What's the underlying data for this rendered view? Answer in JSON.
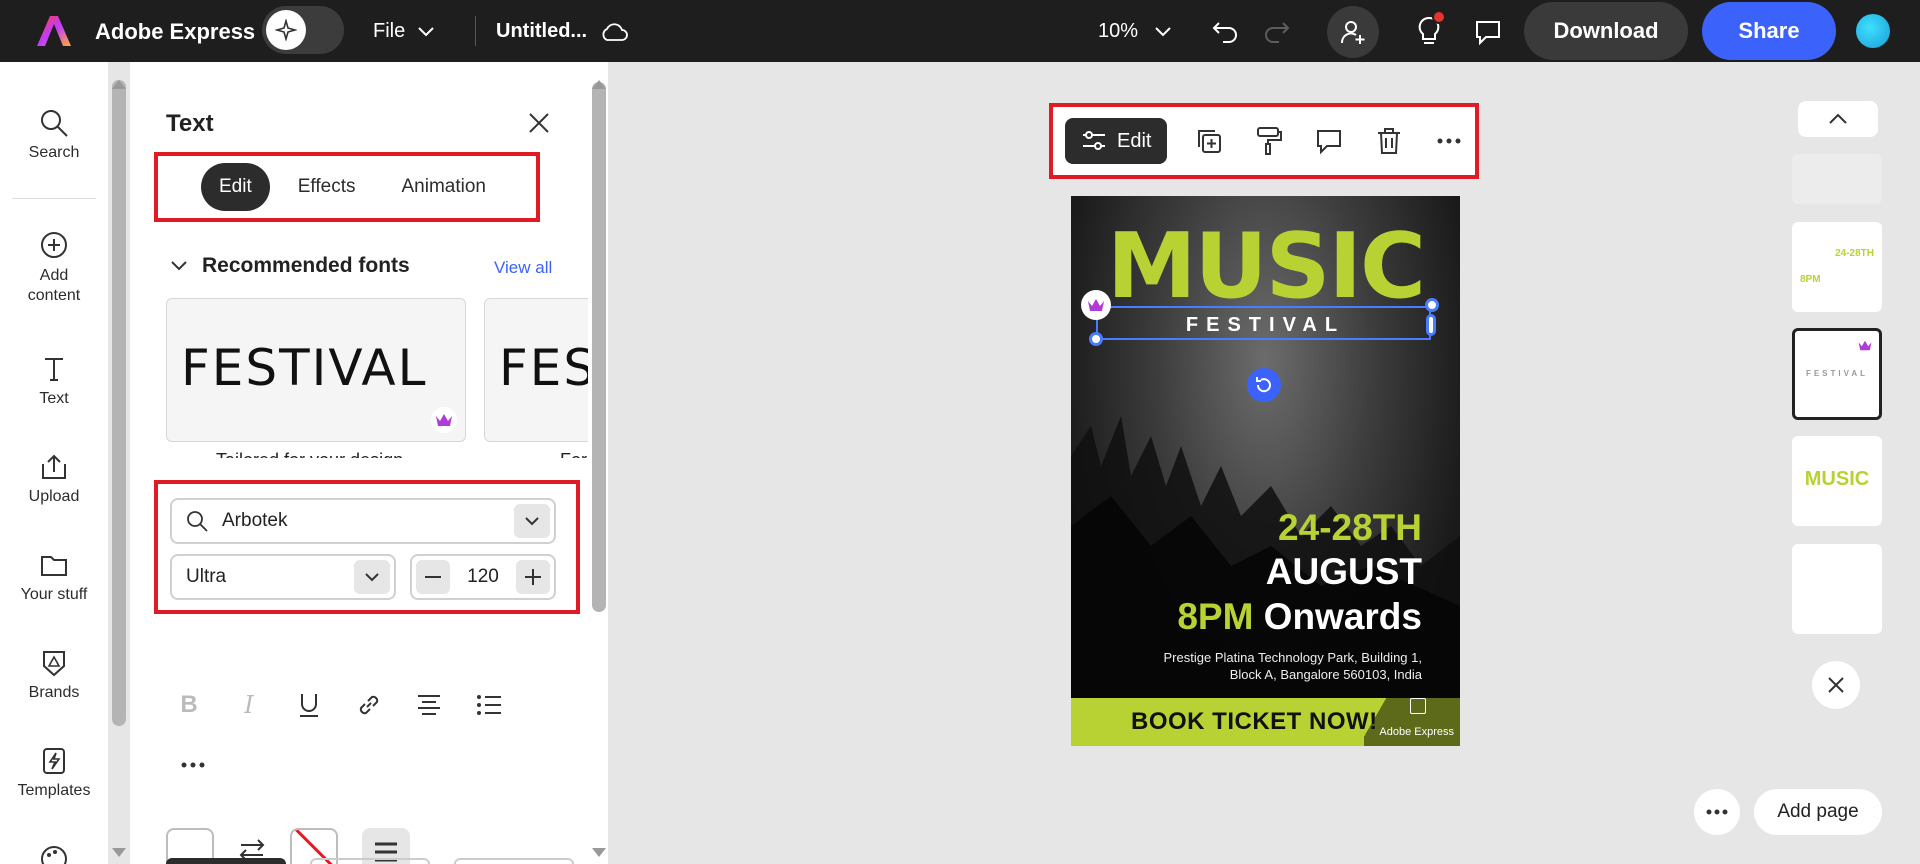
{
  "topbar": {
    "app_title": "Adobe Express",
    "file_label": "File",
    "doc_title": "Untitled...",
    "zoom": "10%",
    "download_label": "Download",
    "share_label": "Share"
  },
  "rail": {
    "items": [
      {
        "label": "Search",
        "icon": "search-icon"
      },
      {
        "label": "Add content",
        "icon": "plus-circle-icon"
      },
      {
        "label": "Text",
        "icon": "text-icon"
      },
      {
        "label": "Upload",
        "icon": "upload-icon"
      },
      {
        "label": "Your stuff",
        "icon": "folder-icon"
      },
      {
        "label": "Brands",
        "icon": "brand-icon"
      },
      {
        "label": "Templates",
        "icon": "templates-icon"
      }
    ]
  },
  "panel": {
    "title": "Text",
    "tabs": [
      {
        "label": "Edit",
        "active": true
      },
      {
        "label": "Effects",
        "active": false
      },
      {
        "label": "Animation",
        "active": false
      }
    ],
    "recommended_heading": "Recommended fonts",
    "view_all": "View all",
    "font_cards": [
      {
        "sample": "FESTIVAL",
        "caption": "Tailored for your design"
      },
      {
        "sample": "FESTIVAL",
        "caption": "For"
      }
    ],
    "font_name": "Arbotek",
    "font_weight": "Ultra",
    "font_size": "120"
  },
  "poster": {
    "title": "MUSIC",
    "subtitle": "FESTIVAL",
    "dates_line1": "24-28TH",
    "dates_line2": "AUGUST",
    "time_green": "8PM",
    "time_white": "Onwards",
    "address_line1": "Prestige Platina Technology Park, Building 1,",
    "address_line2": "Block A, Bangalore 560103, India",
    "banner": "BOOK TICKET NOW!",
    "watermark": "Adobe Express"
  },
  "toolbar": {
    "edit_label": "Edit"
  },
  "pages": {
    "thumb2_line1": "24-28TH",
    "thumb2_line2": "8PM",
    "thumb3_text": "FESTIVAL",
    "thumb4_text": "MUSIC",
    "add_page_label": "Add page"
  },
  "colors": {
    "accent_green": "#b9d233",
    "brand_blue": "#3b63fb",
    "highlight_red": "#e01b24"
  }
}
